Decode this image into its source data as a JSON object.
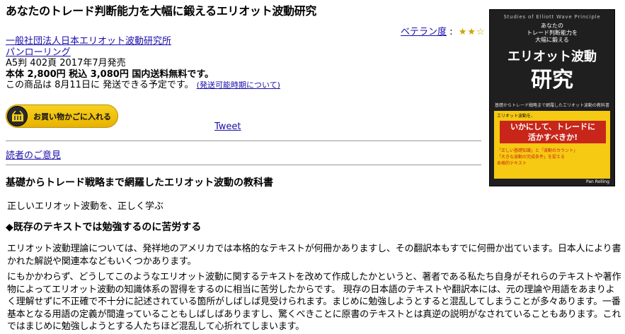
{
  "product": {
    "title": "あなたのトレード判断能力を大幅に鍛えるエリオット波動研究",
    "rating": {
      "label": "ベテラン度",
      "separator": ":",
      "stars": "★★☆"
    },
    "authors": [
      "一般社団法人日本エリオット波動研究所"
    ],
    "publisher": "パンローリング",
    "format": "A5判 402頁 2017年7月発売",
    "price": "本体 2,800円  税込 3,080円  国内送料無料です。",
    "shipping_text": "この商品は 8月11日に 発送できる予定です。",
    "shipping_link": "(発送可能時期について)"
  },
  "actions": {
    "cart_label": "お買い物かごに入れる",
    "tweet_label": "Tweet",
    "reader_opinion": "読者のご意見"
  },
  "description": {
    "subheading": "基礎からトレード戦略まで網羅したエリオット波動の教科書",
    "tagline": "正しいエリオット波動を、正しく学ぶ",
    "section_heading": "◆既存のテキストでは勉強するのに苦労する",
    "paragraphs": [
      "エリオット波動理論については、発祥地のアメリカでは本格的なテキストが何冊かありますし、その翻訳本もすでに何冊か出ています。日本人により書かれた解説や関連本などもいくつかあります。",
      "にもかかわらず、どうしてこのようなエリオット波動に関するテキストを改めて作成したかというと、著者である私たち自身がそれらのテキストや著作物によってエリオット波動の知識体系の習得をするのに相当に苦労したからです。 現存の日本語のテキストや翻訳本には、元の理論や用語をあまりよく理解せずに不正確で不十分に記述されている箇所がしばしば見受けられます。まじめに勉強しようとすると混乱してしまうことが多々あります。一番基本となる用語の定義が間違っていることもしばしばありますし、驚くべきことに原書のテキストとは真逆の説明がなされていることもあります。これではまじめに勉強しようとする人たちほど混乱して心折れてしまいます。"
    ]
  },
  "cover": {
    "series": "Studies of Elliott Wave Principle",
    "subtitle_lines": [
      "あなたの",
      "トレード判断能力を",
      "大幅に鍛える"
    ],
    "title_line1": "エリオット波動",
    "title_line2": "研究",
    "description": "基礎からトレード戦略まで網羅したエリオット波動の教科書",
    "small_label": "エリオット波動を、",
    "red_lines": [
      "いかにして、トレードに",
      "活かすべきか!"
    ],
    "bullets": [
      "「正しい基礎知識」と「波動のカウント」",
      "「大きな波動の完成条件」を捉える",
      "本格的テキスト"
    ],
    "publisher": "Pan Rolling",
    "colors": {
      "background": "#1f1f1f",
      "accent_yellow": "#f6c912",
      "accent_red": "#c8261b"
    }
  },
  "colors": {
    "link": "#1a0dab",
    "star": "#c9a400",
    "cart_yellow": "#f0c316"
  },
  "icons": {
    "cart": "basket-icon",
    "rating": "star-icon"
  }
}
